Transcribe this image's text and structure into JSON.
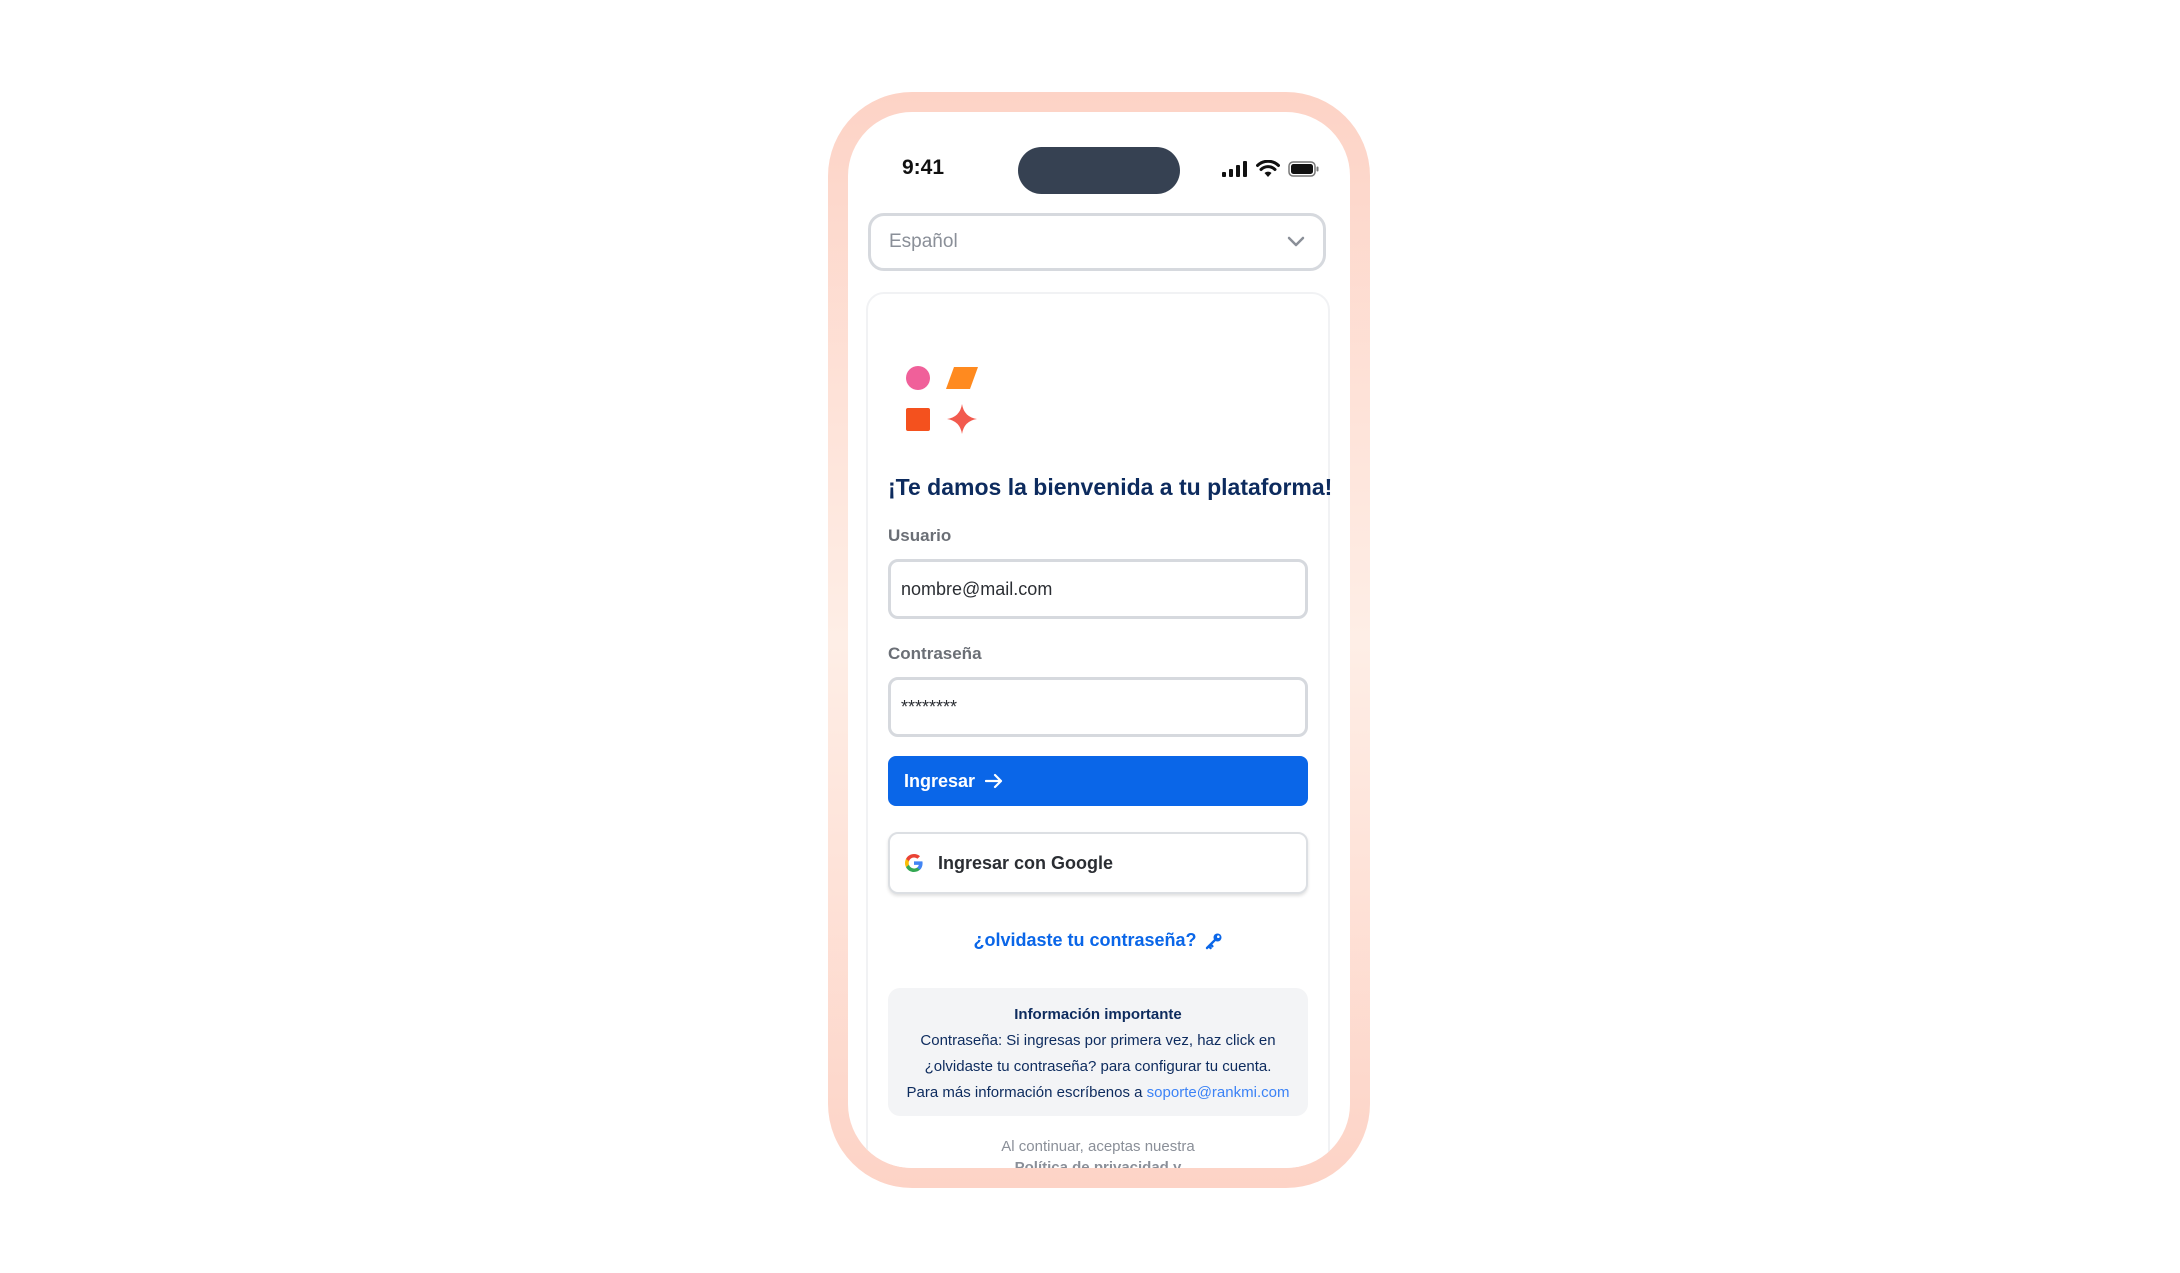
{
  "status_bar": {
    "time": "9:41",
    "icons": [
      "cellular-signal-icon",
      "wifi-icon",
      "battery-icon"
    ]
  },
  "language_select": {
    "selected": "Español",
    "icon": "chevron-down-icon"
  },
  "login": {
    "welcome_title": "¡Te damos la bienvenida a tu plataforma!",
    "username_label": "Usuario",
    "username_value": "nombre@mail.com",
    "password_label": "Contraseña",
    "password_value": "********",
    "submit_label": "Ingresar",
    "google_label": "Ingresar con Google",
    "forgot_label": "¿olvidaste tu contraseña?"
  },
  "info": {
    "title": "Información importante",
    "line1": "Contraseña: Si ingresas por primera vez, haz click en",
    "line2": "¿olvidaste tu contraseña? para configurar tu cuenta.",
    "line3_prefix": "Para más información escríbenos a ",
    "email": "soporte@rankmi.com"
  },
  "legal": {
    "text": "Al continuar, aceptas nuestra",
    "link": "Política de privacidad y"
  },
  "colors": {
    "primary": "#0a66e8",
    "heading": "#0d2b5e",
    "frame": "#fdd3c6",
    "logo_pink": "#f0609a",
    "logo_orange": "#ff8a1f",
    "logo_red_orange": "#f4511e",
    "logo_coral": "#f25a4e"
  }
}
